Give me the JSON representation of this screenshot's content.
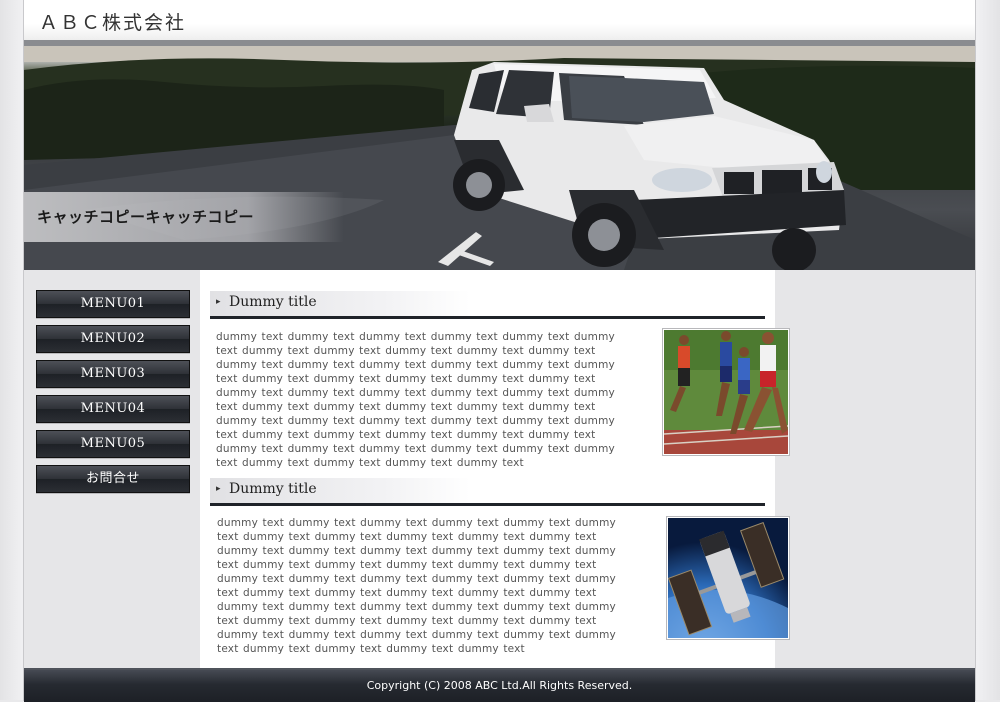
{
  "header": {
    "logo_text": "ＡＢＣ株式会社"
  },
  "hero": {
    "catch_copy": "キャッチコピーキャッチコピー",
    "image": "white-suv-on-road"
  },
  "sidebar": {
    "items": [
      {
        "label": "MENU01"
      },
      {
        "label": "MENU02"
      },
      {
        "label": "MENU03"
      },
      {
        "label": "MENU04"
      },
      {
        "label": "MENU05"
      },
      {
        "label": "お問合せ"
      }
    ]
  },
  "main": {
    "sections": [
      {
        "title": "Dummy title",
        "body": "dummy text dummy text dummy text dummy text dummy text dummy text dummy text dummy text dummy text dummy text dummy text dummy text dummy text dummy text dummy text dummy text dummy text dummy text dummy text dummy text dummy text dummy text dummy text dummy text dummy text dummy text dummy text dummy text dummy text dummy text dummy text dummy text dummy text dummy text dummy text dummy text dummy text dummy text dummy text dummy text dummy text dummy text dummy text dummy text dummy text dummy text dummy text dummy text dummy text dummy text dummy text dummy text dummy text dummy text",
        "image": "runners-photo"
      },
      {
        "title": "Dummy title",
        "body": "dummy text dummy text dummy text dummy text dummy text dummy text dummy text dummy text dummy text dummy text dummy text dummy text dummy text dummy text dummy text dummy text dummy text dummy text dummy text dummy text dummy text dummy text dummy text dummy text dummy text dummy text dummy text dummy text dummy text dummy text dummy text dummy text dummy text dummy text dummy text dummy text dummy text dummy text dummy text dummy text dummy text dummy text dummy text dummy text dummy text dummy text dummy text dummy text dummy text dummy text dummy text dummy text dummy text dummy text",
        "image": "satellite-photo"
      }
    ]
  },
  "footer": {
    "copyright": "Copyright (C) 2008 ABC Ltd.All Rights Reserved."
  },
  "colors": {
    "menu_button": "#2e3137",
    "footer": "#262a31",
    "title_rule": "#1f2329"
  }
}
